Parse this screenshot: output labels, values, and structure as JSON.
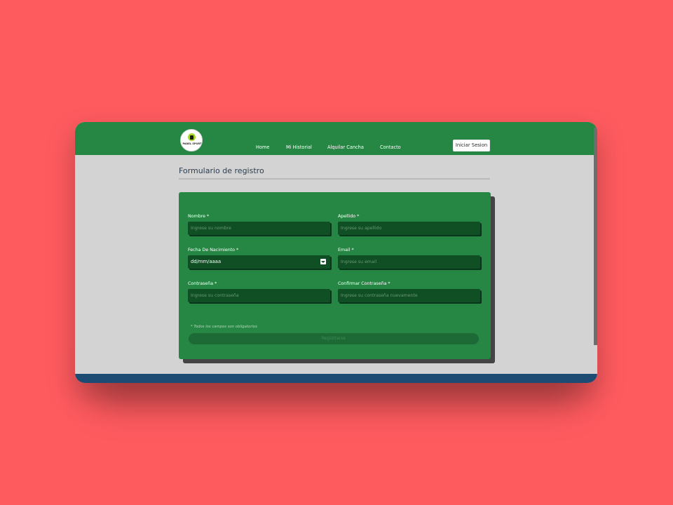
{
  "brand": {
    "logo_text": "PADEL SPORT"
  },
  "nav": {
    "items": [
      {
        "label": "Home"
      },
      {
        "label": "Mi Historial"
      },
      {
        "label": "Alquilar Cancha"
      },
      {
        "label": "Contacto"
      }
    ],
    "login_label": "Iniciar Sesion"
  },
  "page": {
    "title": "Formulario de registro"
  },
  "form": {
    "nombre": {
      "label": "Nombre *",
      "placeholder": "Ingrese su nombre"
    },
    "apellido": {
      "label": "Apellido *",
      "placeholder": "Ingrese su apellido"
    },
    "fecha": {
      "label": "Fecha De Nacimiento *",
      "value": "dd/mm/aaaa"
    },
    "email": {
      "label": "Email *",
      "placeholder": "Ingrese su email"
    },
    "password": {
      "label": "Contraseña *",
      "placeholder": "Ingrese su contraseña"
    },
    "confirm": {
      "label": "Confirmar Contraseña *",
      "placeholder": "Ingrese su contraseña nuevamente"
    },
    "note": "* Todos los campos son obligatorios",
    "submit_label": "Registrarse"
  },
  "colors": {
    "background": "#fe5b5f",
    "navbar": "#268744",
    "form_bg": "#268744",
    "input_bg": "#0f4f23",
    "page_bg": "#d3d3d3"
  }
}
